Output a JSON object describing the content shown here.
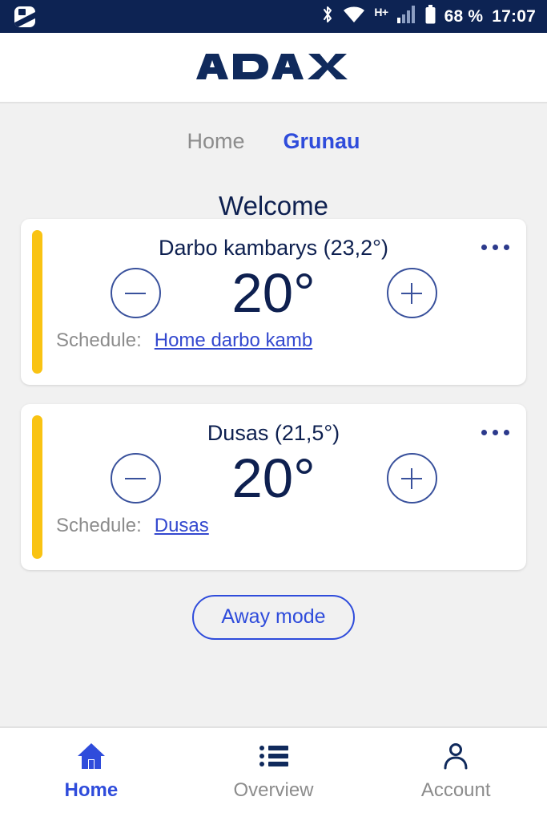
{
  "statusbar": {
    "app_icon": "app-badge-icon",
    "bluetooth_icon": "bluetooth-icon",
    "wifi_icon": "wifi-icon",
    "network_type": "H+",
    "signal_icon": "signal-bars-icon",
    "battery_icon": "battery-icon",
    "battery_level": "68 %",
    "time": "17:07",
    "background_color": "#0d2353"
  },
  "header": {
    "logo_text": "ADAX",
    "logo_color": "#102a5c"
  },
  "tabs": [
    {
      "label": "Home",
      "active": false
    },
    {
      "label": "Grunau",
      "active": true
    }
  ],
  "page_title": "Welcome",
  "cards": [
    {
      "title": "Darbo kambarys (23,2°)",
      "temperature": "20°",
      "schedule_label": "Schedule:",
      "schedule_link": "Home darbo kamb",
      "status_color": "#f9c313",
      "decrease_label": "−",
      "increase_label": "+",
      "menu_label": "•••"
    },
    {
      "title": "Dusas (21,5°)",
      "temperature": "20°",
      "schedule_label": "Schedule:",
      "schedule_link": "Dusas",
      "status_color": "#f9c313",
      "decrease_label": "−",
      "increase_label": "+",
      "menu_label": "•••"
    }
  ],
  "away_button": {
    "label": "Away mode",
    "color": "#2f4cdb"
  },
  "bottom_nav": [
    {
      "label": "Home",
      "icon": "home-icon",
      "active": true
    },
    {
      "label": "Overview",
      "icon": "list-icon",
      "active": false
    },
    {
      "label": "Account",
      "icon": "person-icon",
      "active": false
    }
  ],
  "colors": {
    "accent_blue": "#2f4cdb",
    "dark_navy": "#0e2050",
    "page_background": "#f1f1f1",
    "amber": "#f9c313"
  }
}
